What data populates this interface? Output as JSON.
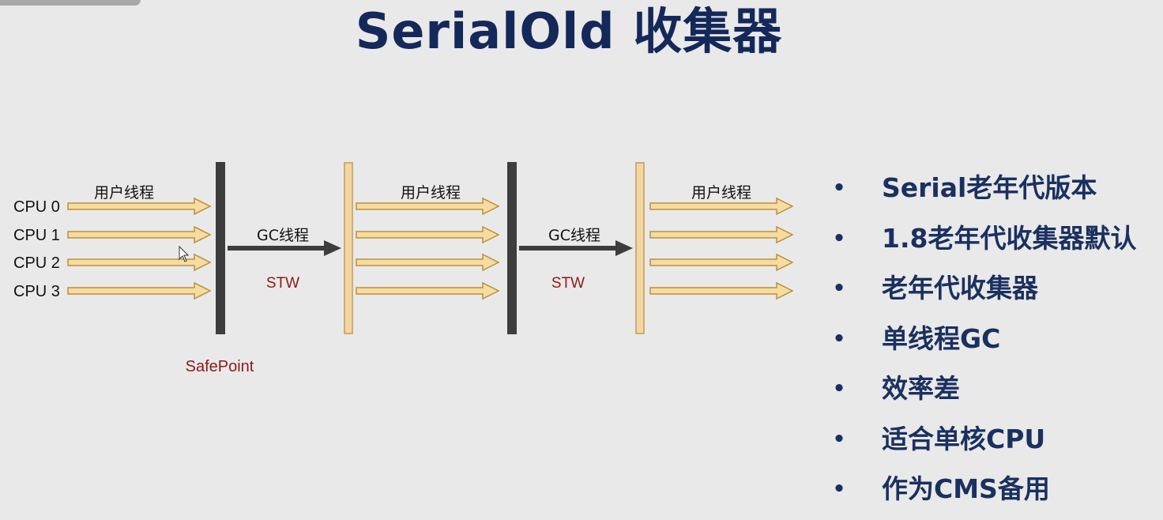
{
  "title": "SerialOld 收集器",
  "diagram": {
    "cpus": [
      "CPU 0",
      "CPU 1",
      "CPU 2",
      "CPU 3"
    ],
    "user_thread_label": "用户线程",
    "gc_thread_label": "GC线程",
    "stw_label": "STW",
    "safepoint_label": "SafePoint",
    "colors": {
      "user_arrow_fill": "#f6dca0",
      "user_arrow_stroke": "#b8913f",
      "gc_arrow": "#3d3d3d",
      "gc_bar": "#3d3d3d",
      "user_bar_fill": "#f3d7a3",
      "user_bar_stroke": "#c39a58",
      "stw_text": "#8b1a1a"
    }
  },
  "bullets": [
    "Serial老年代版本",
    "1.8老年代收集器默认",
    "老年代收集器",
    "单线程GC",
    "效率差",
    "适合单核CPU",
    "作为CMS备用"
  ]
}
